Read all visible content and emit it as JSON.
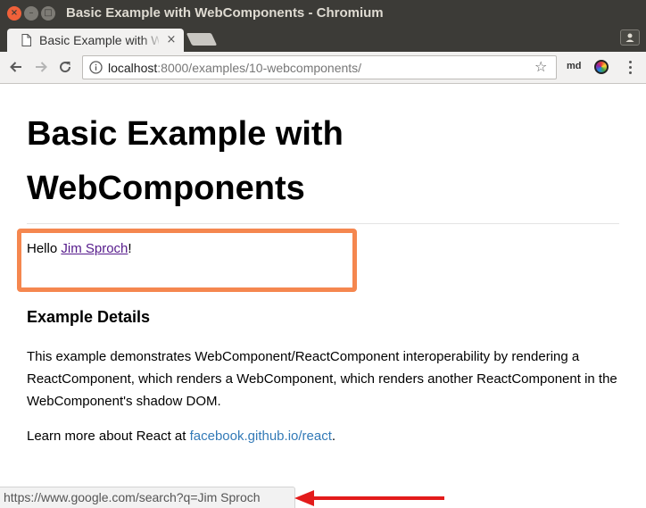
{
  "window": {
    "title": "Basic Example with WebComponents - Chromium",
    "close_glyph": "×",
    "minimize_glyph": "–",
    "maximize_glyph": "□"
  },
  "tab": {
    "title": "Basic Example with WebComponents",
    "close_glyph": "×",
    "doc_icon": "document-icon"
  },
  "toolbar": {
    "url_host": "localhost",
    "url_rest": ":8000/examples/10-webcomponents/",
    "bookmark_glyph": "☆",
    "extension_label": "md",
    "icons": [
      "back-arrow-icon",
      "forward-arrow-icon",
      "reload-icon",
      "info-icon",
      "star-icon",
      "color-wheel-icon",
      "kebab-menu-icon"
    ]
  },
  "page": {
    "title": "Basic Example with WebComponents",
    "hello_prefix": "Hello ",
    "hello_name": "Jim Sproch",
    "hello_suffix": "!",
    "details_heading": "Example Details",
    "description": "This example demonstrates WebComponent/ReactComponent interoperability by rendering a ReactComponent, which renders a WebComponent, which renders another ReactComponent in the WebComponent's shadow DOM.",
    "learn_more_prefix": "Learn more about React at ",
    "learn_more_link": "facebook.github.io/react",
    "learn_more_suffix": "."
  },
  "status_bar": {
    "url": "https://www.google.com/search?q=Jim Sproch"
  },
  "colors": {
    "highlight_box": "#f5874f",
    "annotation_arrow": "#e31b1b",
    "visited_link": "#551a8b",
    "link": "#337ab7",
    "titlebar": "#3c3b37"
  }
}
